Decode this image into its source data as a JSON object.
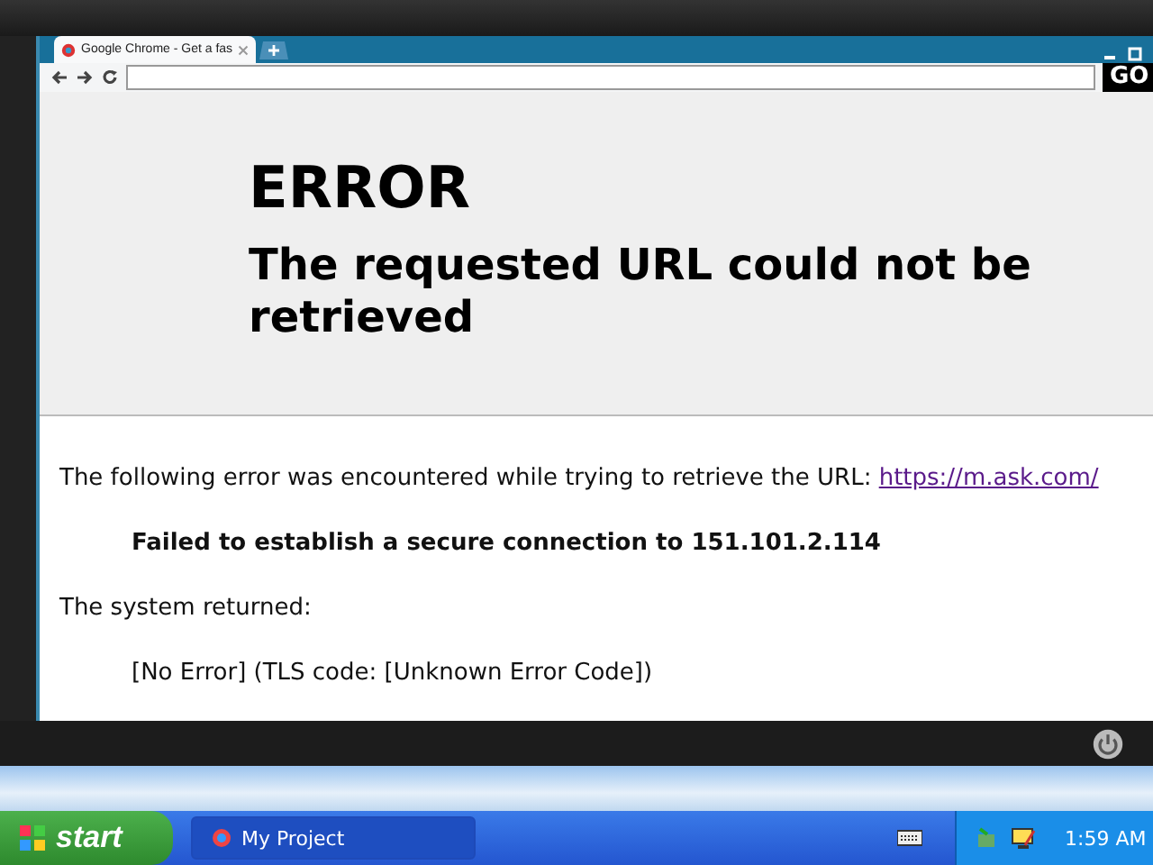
{
  "browser": {
    "tab": {
      "title": "Google Chrome - Get a fas",
      "selected": true
    },
    "go_button": "GO"
  },
  "page": {
    "heading": "ERROR",
    "subheading": "The requested URL could not be retrieved",
    "intro": "The following error was encountered while trying to retrieve the URL: ",
    "url": "https://m.ask.com/",
    "detail": "Failed to establish a secure connection to 151.101.2.114",
    "returned_label": "The system returned:",
    "returned": "[No Error] (TLS code: [Unknown Error Code])"
  },
  "taskbar": {
    "start": "start",
    "tasks": [
      {
        "label": "My Project",
        "selected": true
      }
    ],
    "clock": "1:59 AM"
  }
}
